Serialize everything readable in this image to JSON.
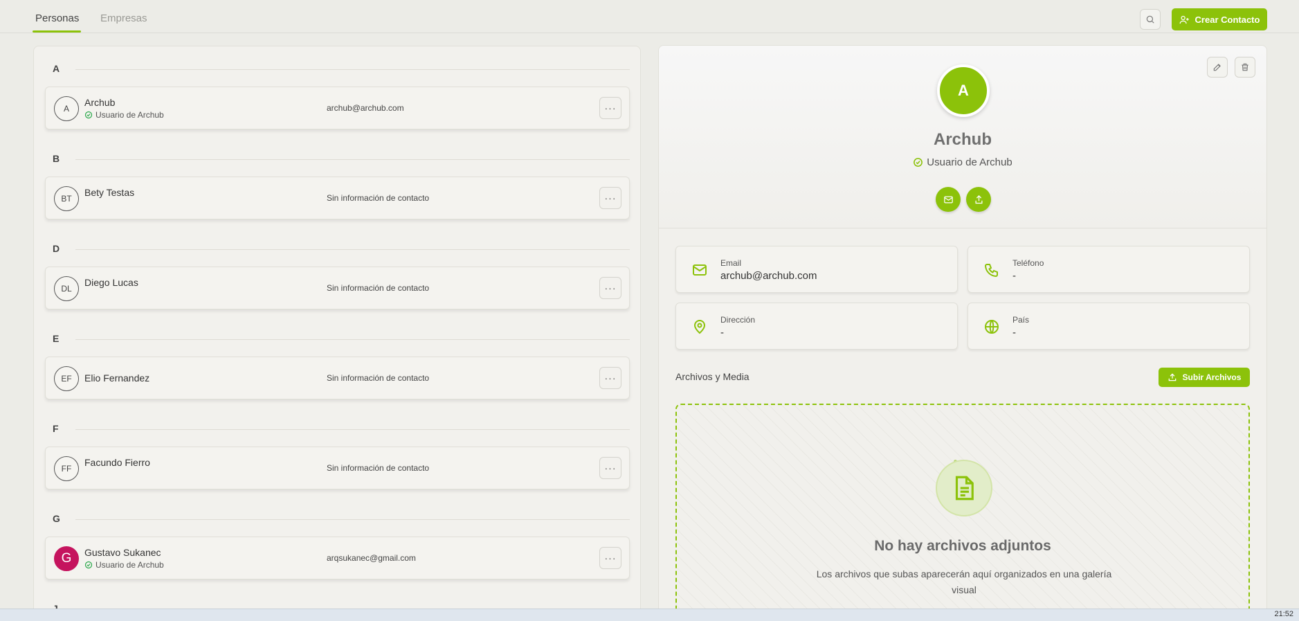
{
  "tabs": [
    {
      "label": "Personas",
      "active": true
    },
    {
      "label": "Empresas",
      "active": false
    }
  ],
  "header": {
    "create_label": "Crear Contacto",
    "accent_color": "#8cc20a"
  },
  "contacts": {
    "groups": [
      {
        "letter": "A",
        "name": "Archub",
        "initials": "A",
        "badge": "Usuario de Archub",
        "info": "archub@archub.com"
      },
      {
        "letter": "B",
        "name": "Bety Testas",
        "initials": "BT",
        "badge": "",
        "info": "Sin información de contacto"
      },
      {
        "letter": "D",
        "name": "Diego Lucas",
        "initials": "DL",
        "badge": "",
        "info": "Sin información de contacto"
      },
      {
        "letter": "E",
        "name": "Elio Fernandez",
        "initials": "EF",
        "badge": "",
        "info": "Sin información de contacto"
      },
      {
        "letter": "F",
        "name": "Facundo Fierro",
        "initials": "FF",
        "badge": "",
        "info": "Sin información de contacto"
      },
      {
        "letter": "G",
        "name": "Gustavo Sukanec",
        "initials": "G",
        "badge": "Usuario de Archub",
        "info": "arqsukanec@gmail.com",
        "avatar_color": "#c5145e"
      }
    ],
    "partial_letter": "J"
  },
  "detail": {
    "initial": "A",
    "name": "Archub",
    "badge": "Usuario de Archub",
    "fields": {
      "email": {
        "label": "Email",
        "value": "archub@archub.com"
      },
      "phone": {
        "label": "Teléfono",
        "value": "-"
      },
      "address": {
        "label": "Dirección",
        "value": "-"
      },
      "country": {
        "label": "País",
        "value": "-"
      }
    },
    "files": {
      "title": "Archivos y Media",
      "upload_label": "Subir Archivos",
      "empty_title": "No hay archivos adjuntos",
      "empty_desc": "Los archivos que subas aparecerán aquí organizados en una galería visual"
    }
  },
  "taskbar": {
    "time": "21:52"
  }
}
